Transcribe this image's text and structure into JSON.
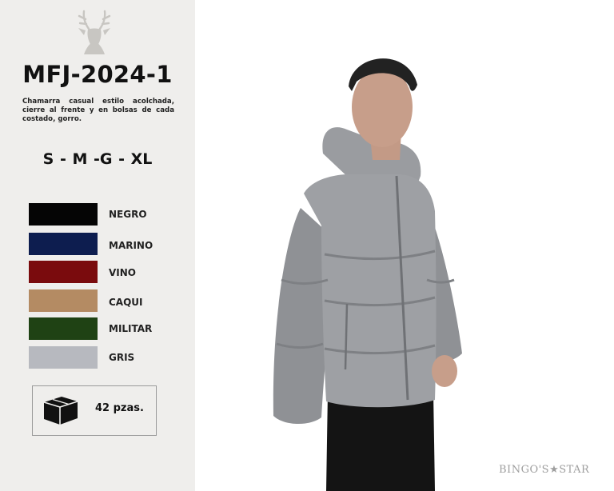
{
  "product": {
    "model": "MFJ-2024-1",
    "description": "Chamarra casual estilo acolchada, cierre al frente y en bolsas de cada costado, gorro.",
    "sizes": "S - M -G - XL",
    "pack": "42 pzas."
  },
  "colors": [
    {
      "name": "NEGRO",
      "hex": "#050505"
    },
    {
      "name": "MARINO",
      "hex": "#0d1d4f"
    },
    {
      "name": "VINO",
      "hex": "#7a0b0d"
    },
    {
      "name": "CAQUI",
      "hex": "#b48b63"
    },
    {
      "name": "MILITAR",
      "hex": "#1f4214"
    },
    {
      "name": "GRIS",
      "hex": "#b7b9bf"
    }
  ],
  "icons": {
    "logo": "deer-head-icon",
    "box": "box-icon"
  },
  "brand": {
    "watermark": "BINGO'S★STAR"
  }
}
